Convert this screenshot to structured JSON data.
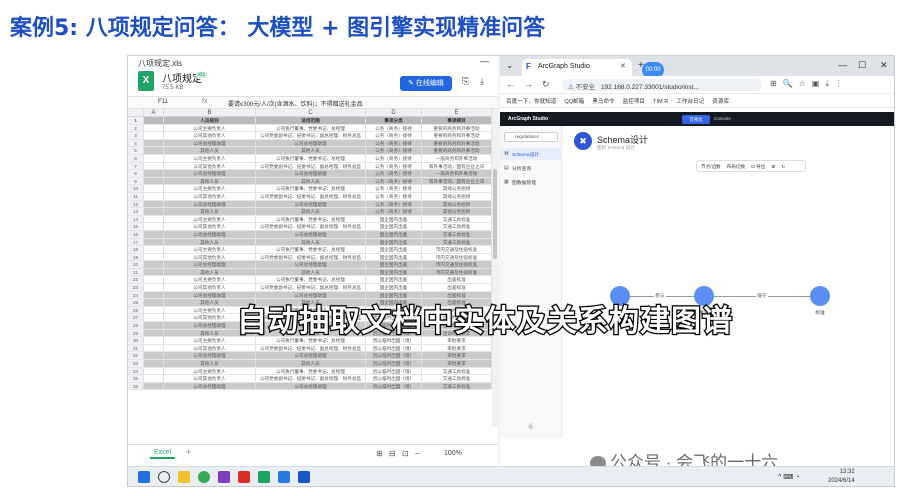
{
  "slide": {
    "title": "案例5: 八项规定问答： 大模型 + 图引擎实现精准问答"
  },
  "caption": "自动抽取文档中实体及关系构建图谱",
  "watermark": "公众号 · 会飞的一十六",
  "excel": {
    "window_filename": "八项规定.xls",
    "doc_title": "八项规定",
    "file_tag": "xls",
    "file_size": "75.5 KB",
    "edit_button": "在线编辑",
    "cell_ref": "F11",
    "formula_icon": "fx",
    "formula_text": "要请≤300元/人/次(含酒水、饮料)；不得赠送礼金品",
    "columns": [
      "",
      "A",
      "B",
      "C",
      "D",
      "E"
    ],
    "header_row": {
      "num": "1",
      "b": "人员级别",
      "c": "适用范围",
      "d": "事项分类",
      "e": "事项细目"
    },
    "rows": [
      {
        "num": "2",
        "dark": false,
        "b": "公司主要负责人",
        "c": "公司执行董事、党委书记、总经理",
        "d": "公务（商务）接待",
        "e": "重要的商务和外事活动"
      },
      {
        "num": "3",
        "dark": false,
        "b": "公司其他负责人",
        "c": "公司党委副书记、纪委书记、副总经理、财务总监",
        "d": "公务（商务）接待",
        "e": "重要的商务和外事活动"
      },
      {
        "num": "4",
        "dark": true,
        "b": "公司总经理助理",
        "c": "公司总经理助理",
        "d": "公务（商务）接待",
        "e": "重要的商务和外事活动"
      },
      {
        "num": "5",
        "dark": true,
        "b": "其他人员",
        "c": "其他人员",
        "d": "公务（商务）接待",
        "e": "重要的商务和外事活动"
      },
      {
        "num": "6",
        "dark": false,
        "b": "公司主要负责人",
        "c": "公司执行董事、党委书记、总经理",
        "d": "公务（商务）接待",
        "e": "一般商务和外事活动"
      },
      {
        "num": "7",
        "dark": false,
        "b": "公司其他负责人",
        "c": "公司党委副书记、纪委书记、副总经理、财务总监",
        "d": "公务（商务）接待",
        "e": "和外事活动，国有企业之间"
      },
      {
        "num": "8",
        "dark": true,
        "b": "公司总经理助理",
        "c": "公司总经理助理",
        "d": "公务（商务）接待",
        "e": "一般商务和外事活动"
      },
      {
        "num": "9",
        "dark": true,
        "b": "其他人员",
        "c": "其他人员",
        "d": "公务（商务）接待",
        "e": "和外事活动，国有企业之间"
      },
      {
        "num": "10",
        "dark": false,
        "b": "公司主要负责人",
        "c": "公司执行董事、党委书记、总经理",
        "d": "公务（商务）接待",
        "e": "其他公务招待"
      },
      {
        "num": "11",
        "dark": false,
        "b": "公司其他负责人",
        "c": "公司党委副书记、纪委书记、副总经理、财务总监",
        "d": "公务（商务）接待",
        "e": "其他公务招待"
      },
      {
        "num": "12",
        "dark": true,
        "b": "公司总经理助理",
        "c": "公司总经理助理",
        "d": "公务（商务）接待",
        "e": "其他公务招待"
      },
      {
        "num": "13",
        "dark": true,
        "b": "其他人员",
        "c": "其他人员",
        "d": "公务（商务）接待",
        "e": "其他公务招待"
      },
      {
        "num": "14",
        "dark": false,
        "b": "公司主要负责人",
        "c": "公司执行董事、党委书记、总经理",
        "d": "国企国内出差",
        "e": "交通工具标准"
      },
      {
        "num": "15",
        "dark": false,
        "b": "公司其他负责人",
        "c": "公司党委副书记、纪委书记、副总经理、财务总监",
        "d": "国企国内出差",
        "e": "交通工具标准"
      },
      {
        "num": "16",
        "dark": true,
        "b": "公司总经理助理",
        "c": "公司总经理助理",
        "d": "国企国内出差",
        "e": "交通工具标准"
      },
      {
        "num": "17",
        "dark": true,
        "b": "其他人员",
        "c": "其他人员",
        "d": "国企国内出差",
        "e": "交通工具标准"
      },
      {
        "num": "18",
        "dark": false,
        "b": "公司主要负责人",
        "c": "公司执行董事、党委书记、总经理",
        "d": "国企国内出差",
        "e": "市内交通及住宿标准"
      },
      {
        "num": "19",
        "dark": false,
        "b": "公司其他负责人",
        "c": "公司党委副书记、纪委书记、副总经理、财务总监",
        "d": "国企国内出差",
        "e": "市内交通及住宿标准"
      },
      {
        "num": "20",
        "dark": true,
        "b": "公司总经理助理",
        "c": "公司总经理助理",
        "d": "国企国内出差",
        "e": "市内交通及住宿标准"
      },
      {
        "num": "21",
        "dark": true,
        "b": "其他人员",
        "c": "其他人员",
        "d": "国企国内出差",
        "e": "市内交通及住宿标准"
      },
      {
        "num": "22",
        "dark": false,
        "b": "公司主要负责人",
        "c": "公司执行董事、党委书记、总经理",
        "d": "国企国内出差",
        "e": "出差标准"
      },
      {
        "num": "23",
        "dark": false,
        "b": "公司其他负责人",
        "c": "公司党委副书记、纪委书记、副总经理、财务总监",
        "d": "国企国内出差",
        "e": "出差标准"
      },
      {
        "num": "24",
        "dark": true,
        "b": "公司总经理助理",
        "c": "公司总经理助理",
        "d": "国企国内出差",
        "e": "出差标准"
      },
      {
        "num": "25",
        "dark": true,
        "b": "其他人员",
        "c": "其他人员",
        "d": "国企国内出差",
        "e": "出差标准"
      },
      {
        "num": "26",
        "dark": false,
        "b": "公司主要负责人",
        "c": "公司执行董事、党委书记、总经理",
        "d": "因公临时出国（境）",
        "e": "出访时限要求"
      },
      {
        "num": "27",
        "dark": false,
        "b": "公司其他负责人",
        "c": "公司党委副书记、纪委书记、副总经理、财务总监",
        "d": "因公临时出国（境）",
        "e": "出访时限要求"
      },
      {
        "num": "28",
        "dark": true,
        "b": "公司总经理助理",
        "c": "公司总经理助理",
        "d": "因公临时出国（境）",
        "e": "出访时限要求"
      },
      {
        "num": "29",
        "dark": true,
        "b": "其他人员",
        "c": "其他人员",
        "d": "因公临时出国（境）",
        "e": "出访时限要求"
      },
      {
        "num": "30",
        "dark": false,
        "b": "公司主要负责人",
        "c": "公司执行董事、党委书记、总经理",
        "d": "因公临时出国（境）",
        "e": "审批要求"
      },
      {
        "num": "31",
        "dark": false,
        "b": "公司其他负责人",
        "c": "公司党委副书记、纪委书记、副总经理、财务总监",
        "d": "因公临时出国（境）",
        "e": "审批要求"
      },
      {
        "num": "32",
        "dark": true,
        "b": "公司总经理助理",
        "c": "公司总经理助理",
        "d": "因公临时出国（境）",
        "e": "审批要求"
      },
      {
        "num": "33",
        "dark": true,
        "b": "其他人员",
        "c": "其他人员",
        "d": "因公临时出国（境）",
        "e": "审批要求"
      },
      {
        "num": "34",
        "dark": false,
        "b": "公司主要负责人",
        "c": "公司执行董事、党委书记、总经理",
        "d": "因公临时出国（境）",
        "e": "交通工具标准"
      },
      {
        "num": "35",
        "dark": false,
        "b": "公司其他负责人",
        "c": "公司党委副书记、纪委书记、副总经理、财务总监",
        "d": "因公临时出国（境）",
        "e": "交通工具标准"
      },
      {
        "num": "36",
        "dark": true,
        "b": "公司总经理助理",
        "c": "公司总经理助理",
        "d": "因公临时出国（境）",
        "e": "交通工具标准"
      }
    ],
    "sheet_tab": "Excel",
    "add_sheet": "+",
    "zoom": "100%"
  },
  "browser": {
    "tab_title": "ArcGraph Studio",
    "url_warning": "⚠ 不安全",
    "url": "192.168.0.227:33001/studio/inst...",
    "zoom_badge": "00:00",
    "bookmarks": [
      "百度一下，你就知道",
      "QQ邮箱",
      "黑马命令",
      "监控项目",
      "TIM R",
      "工作台日记",
      "资源库"
    ],
    "app": {
      "brand": "ArcGraph Studio",
      "tab_active": "可视化",
      "tab_console": "Console",
      "graph_select": "regulation4",
      "side_items": [
        "Schema设计",
        "分析查询",
        "图数据管理"
      ],
      "side_footer": "设",
      "schema_title": "Schema设计",
      "schema_sub": "图的 Schema 设计",
      "tools": [
        "节点/边数",
        "布局切换",
        "⊡ 导出",
        "⊞",
        "↻"
      ],
      "nodes": [
        "人员",
        "事项",
        "标准"
      ],
      "edges": [
        "参与",
        "遵守"
      ]
    }
  },
  "taskbar": {
    "time": "13:32",
    "date": "2024/6/14"
  }
}
